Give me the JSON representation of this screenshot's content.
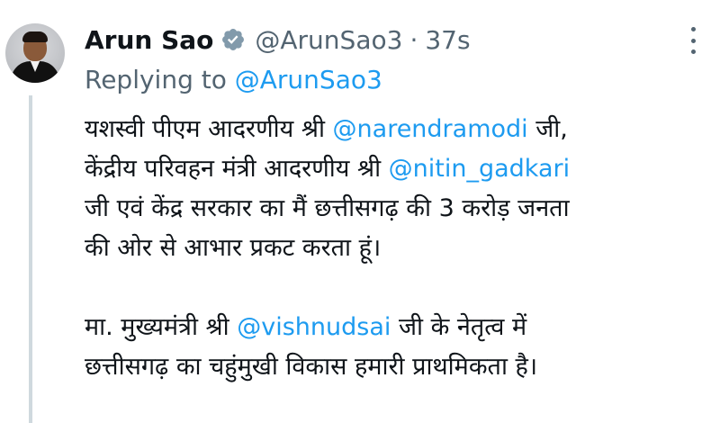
{
  "author": {
    "name": "Arun Sao",
    "handle": "@ArunSao3",
    "separator": "·",
    "time": "37s"
  },
  "reply": {
    "prefix": "Replying to ",
    "mention": "@ArunSao3"
  },
  "tweet": {
    "l1_a": "यशस्वी पीएम आदरणीय श्री ",
    "l1_m": "@narendramodi",
    "l1_b": " जी,",
    "l2_a": "केंद्रीय परिवहन मंत्री आदरणीय श्री ",
    "l2_m": "@nitin_gadkari",
    "l3": "जी एवं केंद्र सरकार का मैं छत्तीसगढ़ की 3 करोड़ जनता",
    "l4": "की ओर से आभार प्रकट करता हूं।",
    "l5_a": "मा. मुख्यमंत्री श्री ",
    "l5_m": "@vishnudsai",
    "l5_b": " जी के नेतृत्व में",
    "l6": "छत्तीसगढ़ का चहुंमुखी विकास हमारी प्राथमिकता है।"
  },
  "colors": {
    "link": "#1d9bf0",
    "secondary": "#536471",
    "text": "#0f1419",
    "verified": "#829aab"
  },
  "icons": {
    "verified": "verified-badge-icon",
    "more": "more-options-icon"
  }
}
